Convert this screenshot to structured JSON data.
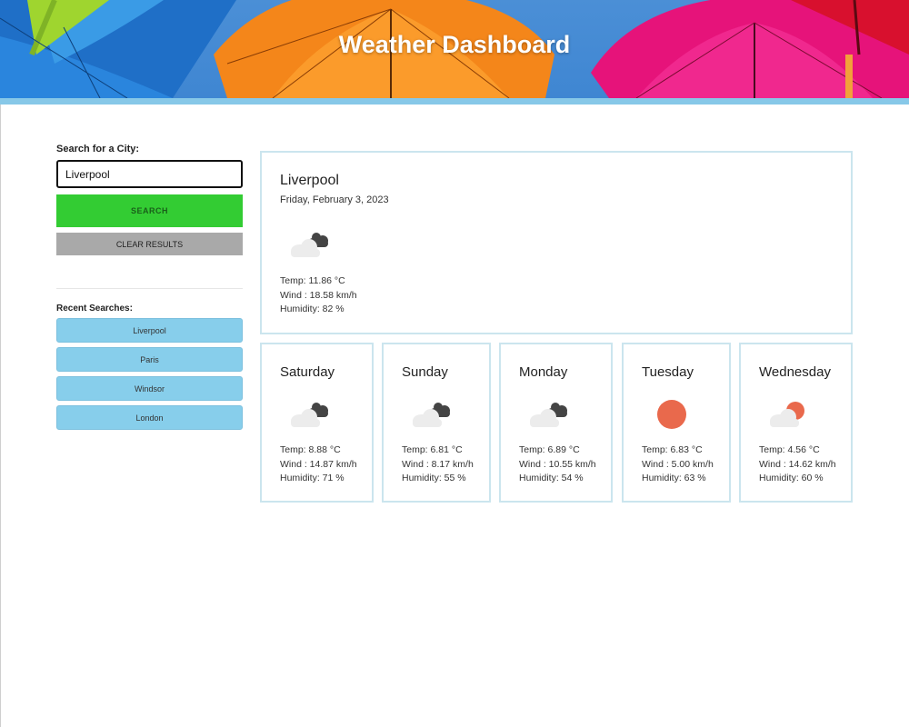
{
  "header": {
    "title": "Weather Dashboard"
  },
  "search": {
    "label": "Search for a City:",
    "value": "Liverpool",
    "search_button": "SEARCH",
    "clear_button": "CLEAR RESULTS"
  },
  "recent": {
    "label": "Recent Searches:",
    "items": [
      "Liverpool",
      "Paris",
      "Windsor",
      "London"
    ]
  },
  "current": {
    "city": "Liverpool",
    "date": "Friday, February 3, 2023",
    "icon": "cloudy-icon",
    "temp": "Temp: 11.86 °C",
    "wind": "Wind : 18.58 km/h",
    "humidity": "Humidity: 82 %"
  },
  "forecast": [
    {
      "day": "Saturday",
      "icon": "cloudy-icon",
      "temp": "Temp: 8.88 °C",
      "wind": "Wind : 14.87 km/h",
      "humidity": "Humidity: 71 %"
    },
    {
      "day": "Sunday",
      "icon": "cloudy-icon",
      "temp": "Temp: 6.81 °C",
      "wind": "Wind : 8.17 km/h",
      "humidity": "Humidity: 55 %"
    },
    {
      "day": "Monday",
      "icon": "cloudy-icon",
      "temp": "Temp: 6.89 °C",
      "wind": "Wind : 10.55 km/h",
      "humidity": "Humidity: 54 %"
    },
    {
      "day": "Tuesday",
      "icon": "sun-icon",
      "temp": "Temp: 6.83 °C",
      "wind": "Wind : 5.00 km/h",
      "humidity": "Humidity: 63 %"
    },
    {
      "day": "Wednesday",
      "icon": "partly-cloudy-icon",
      "temp": "Temp: 4.56 °C",
      "wind": "Wind : 14.62 km/h",
      "humidity": "Humidity: 60 %"
    }
  ],
  "colors": {
    "search_button": "#33cc33",
    "clear_button": "#a9a9a9",
    "recent_item": "#87ceeb",
    "card_border": "#cbe5ee",
    "sun": "#e9694c"
  }
}
